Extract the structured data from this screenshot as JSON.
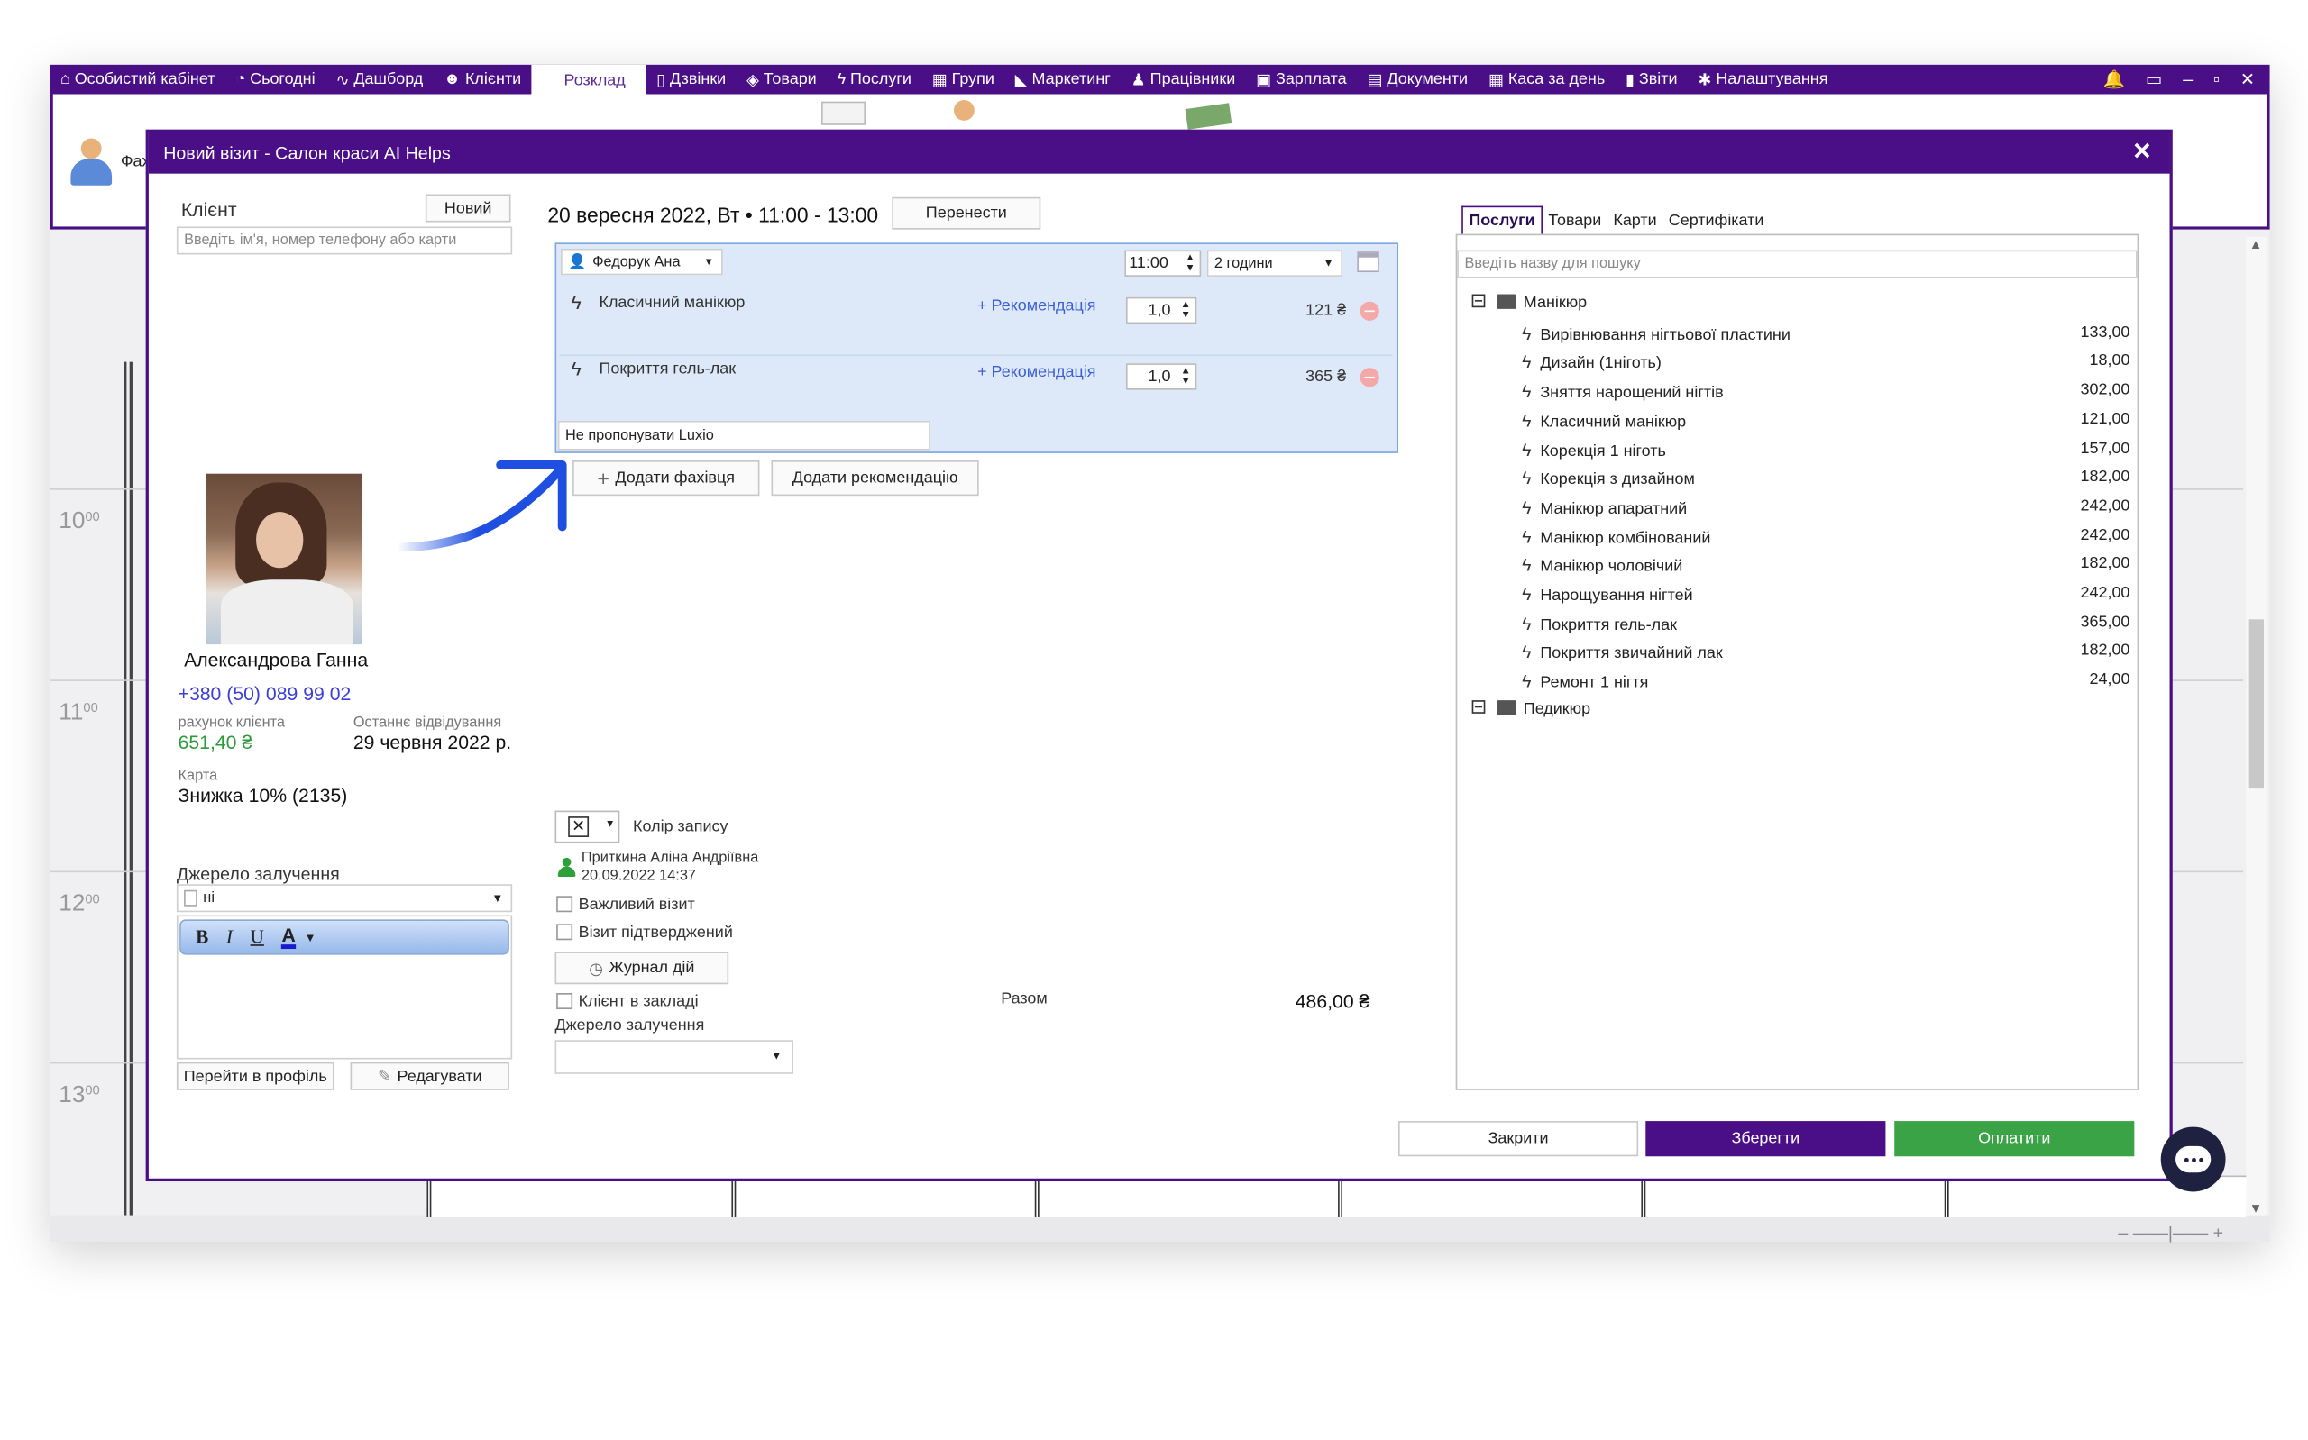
{
  "topnav": {
    "items": [
      {
        "icon": "home-icon",
        "glyph": "⌂",
        "label": "Особистий кабінет"
      },
      {
        "icon": "clock-icon",
        "glyph": "◔",
        "label": "Сьогодні"
      },
      {
        "icon": "pulse-icon",
        "glyph": "∿",
        "label": "Дашборд"
      },
      {
        "icon": "user-circle-icon",
        "glyph": "☻",
        "label": "Клієнти"
      },
      {
        "icon": "",
        "glyph": "",
        "label": "Розклад"
      },
      {
        "icon": "phone-icon",
        "glyph": "▯",
        "label": "Дзвінки"
      },
      {
        "icon": "box-icon",
        "glyph": "◈",
        "label": "Товари"
      },
      {
        "icon": "bolt-icon",
        "glyph": "ϟ",
        "label": "Послуги"
      },
      {
        "icon": "group-icon",
        "glyph": "▦",
        "label": "Групи"
      },
      {
        "icon": "megaphone-icon",
        "glyph": "◣",
        "label": "Маркетинг"
      },
      {
        "icon": "person-icon",
        "glyph": "♟",
        "label": "Працівники"
      },
      {
        "icon": "money-icon",
        "glyph": "▣",
        "label": "Зарплата"
      },
      {
        "icon": "document-icon",
        "glyph": "▤",
        "label": "Документи"
      },
      {
        "icon": "calculator-icon",
        "glyph": "▦",
        "label": "Каса за день"
      },
      {
        "icon": "bar-chart-icon",
        "glyph": "▮",
        "label": "Звіти"
      },
      {
        "icon": "gear-icon",
        "glyph": "✱",
        "label": "Налаштування"
      }
    ],
    "controls": {
      "bell": "🔔",
      "save": "▭",
      "minimize": "–",
      "maximize": "▫",
      "close": "✕"
    }
  },
  "subbar": {
    "partial_label": "Фах"
  },
  "calendar": {
    "hours": [
      {
        "hour": "10",
        "min": "00"
      },
      {
        "hour": "11",
        "min": "00"
      },
      {
        "hour": "12",
        "min": "00"
      },
      {
        "hour": "13",
        "min": "00"
      }
    ],
    "zoom": "– ——|—— +"
  },
  "dialog": {
    "title": "Новий візит - Салон краси AI Helps",
    "close": "✕"
  },
  "client": {
    "label": "Клієнт",
    "new_button": "Новий",
    "search_placeholder": "Введіть ім'я, номер телефону або карти",
    "name": "Александрова Ганна",
    "phone": "+380 (50) 089 99 02",
    "account_label": "рахунок клієнта",
    "account_value": "651,40 ₴",
    "last_visit_label": "Останнє відвідування",
    "last_visit_value": "29 червня 2022 р.",
    "card_label": "Карта",
    "card_value": "Знижка 10% (2135)",
    "source_label": "Джерело залучення",
    "source_value": "ні",
    "rte": {
      "bold": "B",
      "italic": "I",
      "underline": "U",
      "color": "A"
    },
    "profile_button": "Перейти в профіль",
    "edit_button": "Редагувати"
  },
  "visit": {
    "datetime": "20 вересня 2022, Вт • 11:00 - 13:00",
    "reschedule_button": "Перенести",
    "master": "Федорук Ана",
    "start_time": "11:00",
    "duration": "2 години",
    "services": [
      {
        "name": "Класичний манікюр",
        "rec": "+ Рекомендація",
        "qty": "1,0",
        "price": "121 ₴"
      },
      {
        "name": "Покриття гель-лак",
        "rec": "+ Рекомендація",
        "qty": "1,0",
        "price": "365 ₴"
      }
    ],
    "comment": "Не пропонувати Luxio",
    "add_specialist_button": "Додати фахівця",
    "add_recommendation_button": "Додати рекомендацію",
    "color_label": "Колір запису",
    "created_by": "Приткина Аліна Андріївна",
    "created_at": "20.09.2022 14:37",
    "important_label": "Важливий візит",
    "confirmed_label": "Візит підтверджений",
    "journal_button": "Журнал дій",
    "client_in_place_label": "Клієнт в закладі",
    "source_label": "Джерело залучення",
    "total_label": "Разом",
    "total_value": "486,00 ₴"
  },
  "catalog": {
    "tabs": [
      "Послуги",
      "Товари",
      "Карти",
      "Сертифікати"
    ],
    "search_placeholder": "Введіть назву для пошуку",
    "folders": [
      {
        "name": "Манікюр",
        "items": [
          {
            "name": "Вирівнювання нігтьової пластини",
            "price": "133,00"
          },
          {
            "name": "Дизайн (1ніготь)",
            "price": "18,00"
          },
          {
            "name": "Зняття нарощений нігтів",
            "price": "302,00"
          },
          {
            "name": "Класичний манікюр",
            "price": "121,00"
          },
          {
            "name": "Корекція 1 ніготь",
            "price": "157,00"
          },
          {
            "name": "Корекція з дизайном",
            "price": "182,00"
          },
          {
            "name": "Манікюр апаратний",
            "price": "242,00"
          },
          {
            "name": "Манікюр комбінований",
            "price": "242,00"
          },
          {
            "name": "Манікюр чоловічий",
            "price": "182,00"
          },
          {
            "name": "Нарощування нігтей",
            "price": "242,00"
          },
          {
            "name": "Покриття гель-лак",
            "price": "365,00"
          },
          {
            "name": "Покриття звичайний лак",
            "price": "182,00"
          },
          {
            "name": "Ремонт 1 нігтя",
            "price": "24,00"
          }
        ]
      },
      {
        "name": "Педикюр",
        "items": []
      }
    ]
  },
  "footer": {
    "close_button": "Закрити",
    "save_button": "Зберегти",
    "pay_button": "Оплатити"
  },
  "colors": {
    "brand": "#4a0f86",
    "pay": "#3aa346",
    "link": "#3b5ed9",
    "positive": "#2e9a3a",
    "arrow": "#1f4fe0"
  }
}
